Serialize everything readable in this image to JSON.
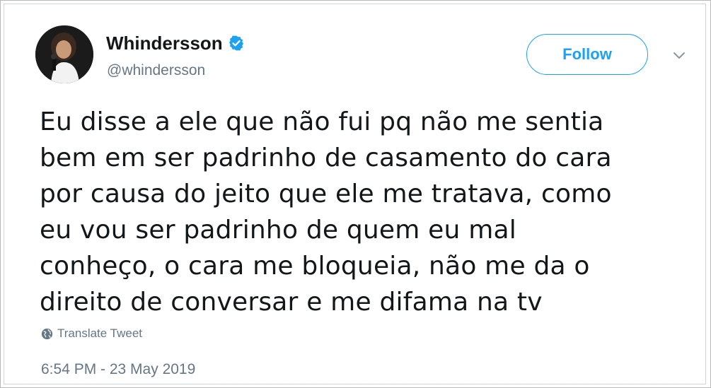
{
  "author": {
    "display_name": "Whindersson",
    "handle": "@whindersson",
    "verified": true,
    "avatar_icon": "profile-photo"
  },
  "follow_button": {
    "label": "Follow"
  },
  "menu": {
    "icon": "chevron-down-icon"
  },
  "tweet": {
    "lines": [
      "Eu disse a ele que não fui pq não me sentia",
      "bem em ser padrinho de casamento do cara",
      "por causa do jeito que ele me tratava, como",
      "eu vou ser padrinho de quem eu mal",
      "conheço, o cara me bloqueia, não me da o",
      "direito de conversar e me difama na tv"
    ]
  },
  "translate": {
    "label": "Translate Tweet",
    "icon": "globe-icon"
  },
  "timestamp": "6:54 PM - 23 May 2019",
  "colors": {
    "accent": "#1da1f2",
    "text": "#14171a",
    "muted": "#657786"
  }
}
